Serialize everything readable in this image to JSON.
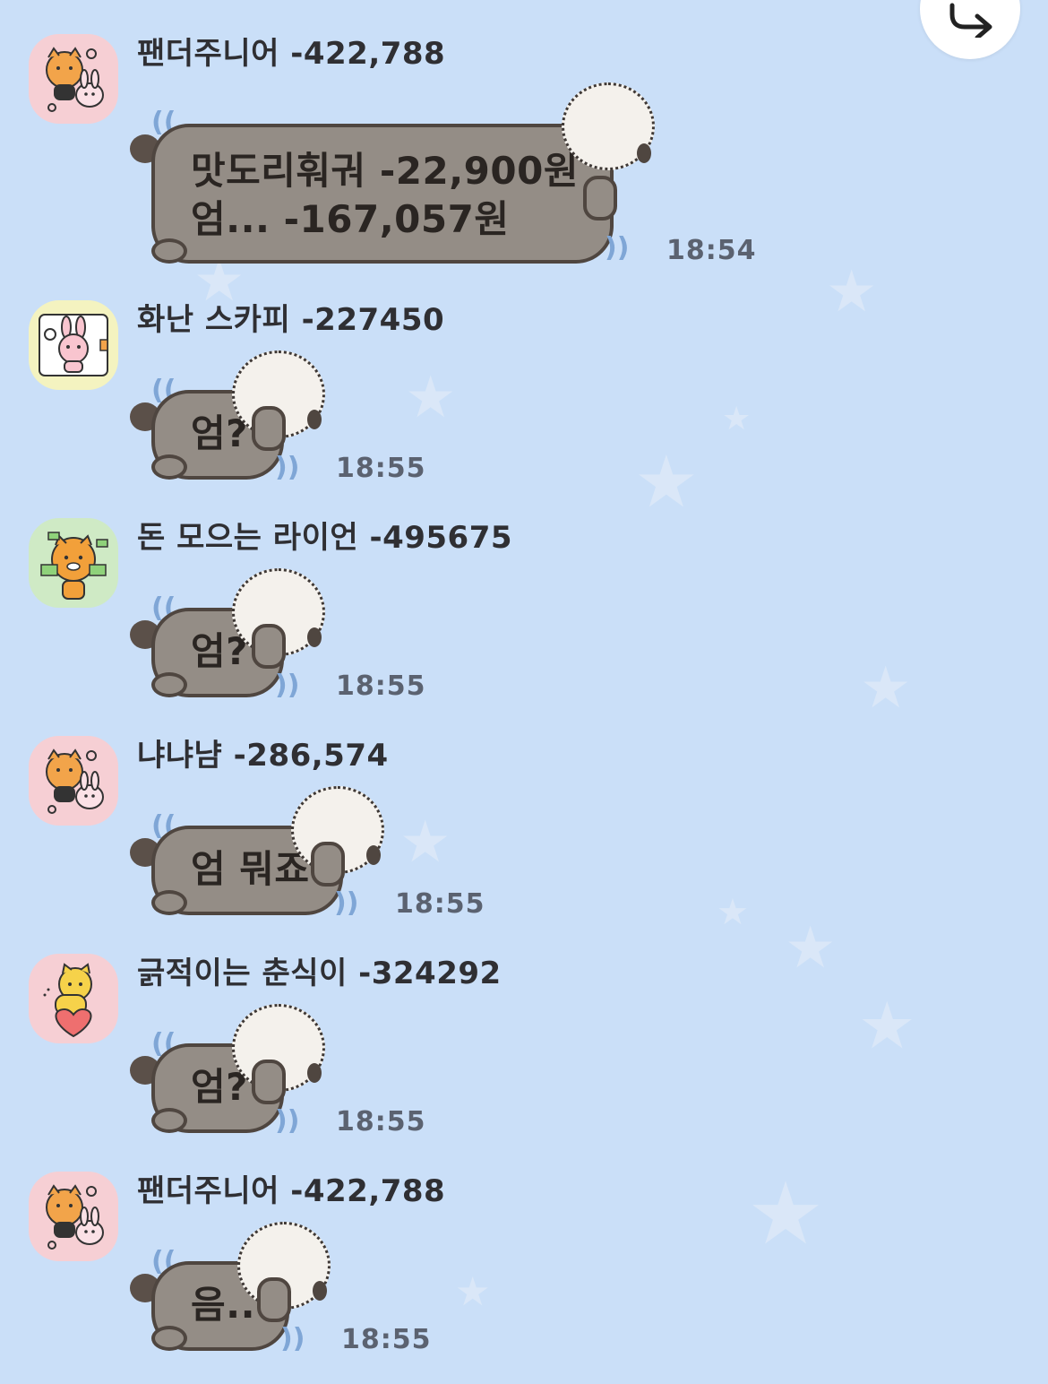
{
  "colors": {
    "background": "#cadff8",
    "bubble_fill": "#948d86",
    "bubble_outline": "#4f4640",
    "name_text": "#2f2f33",
    "time_text": "#5b6270"
  },
  "header": {
    "share_icon": "share-forward-icon"
  },
  "messages": [
    {
      "sender": "팬더주니어 -422,788",
      "avatar": "lion-and-rabbit-sticker",
      "lines": [
        "맛도리훠궈  -22,900원",
        "엄...  -167,057원"
      ],
      "time": "18:54"
    },
    {
      "sender": "화난 스카피 -227450",
      "avatar": "rabbit-in-box-sticker",
      "lines": [
        "엄?"
      ],
      "time": "18:55"
    },
    {
      "sender": "돈 모으는 라이언 -495675",
      "avatar": "lion-money-sticker",
      "lines": [
        "엄?"
      ],
      "time": "18:55"
    },
    {
      "sender": "냐냐냠 -286,574",
      "avatar": "lion-and-rabbit-sticker",
      "lines": [
        "엄 뭐죠"
      ],
      "time": "18:55"
    },
    {
      "sender": "긁적이는 춘식이 -324292",
      "avatar": "cat-with-heart-sticker",
      "lines": [
        "엄?"
      ],
      "time": "18:55"
    },
    {
      "sender": "팬더주니어 -422,788",
      "avatar": "lion-and-rabbit-sticker",
      "lines": [
        "음.."
      ],
      "time": "18:55"
    }
  ]
}
